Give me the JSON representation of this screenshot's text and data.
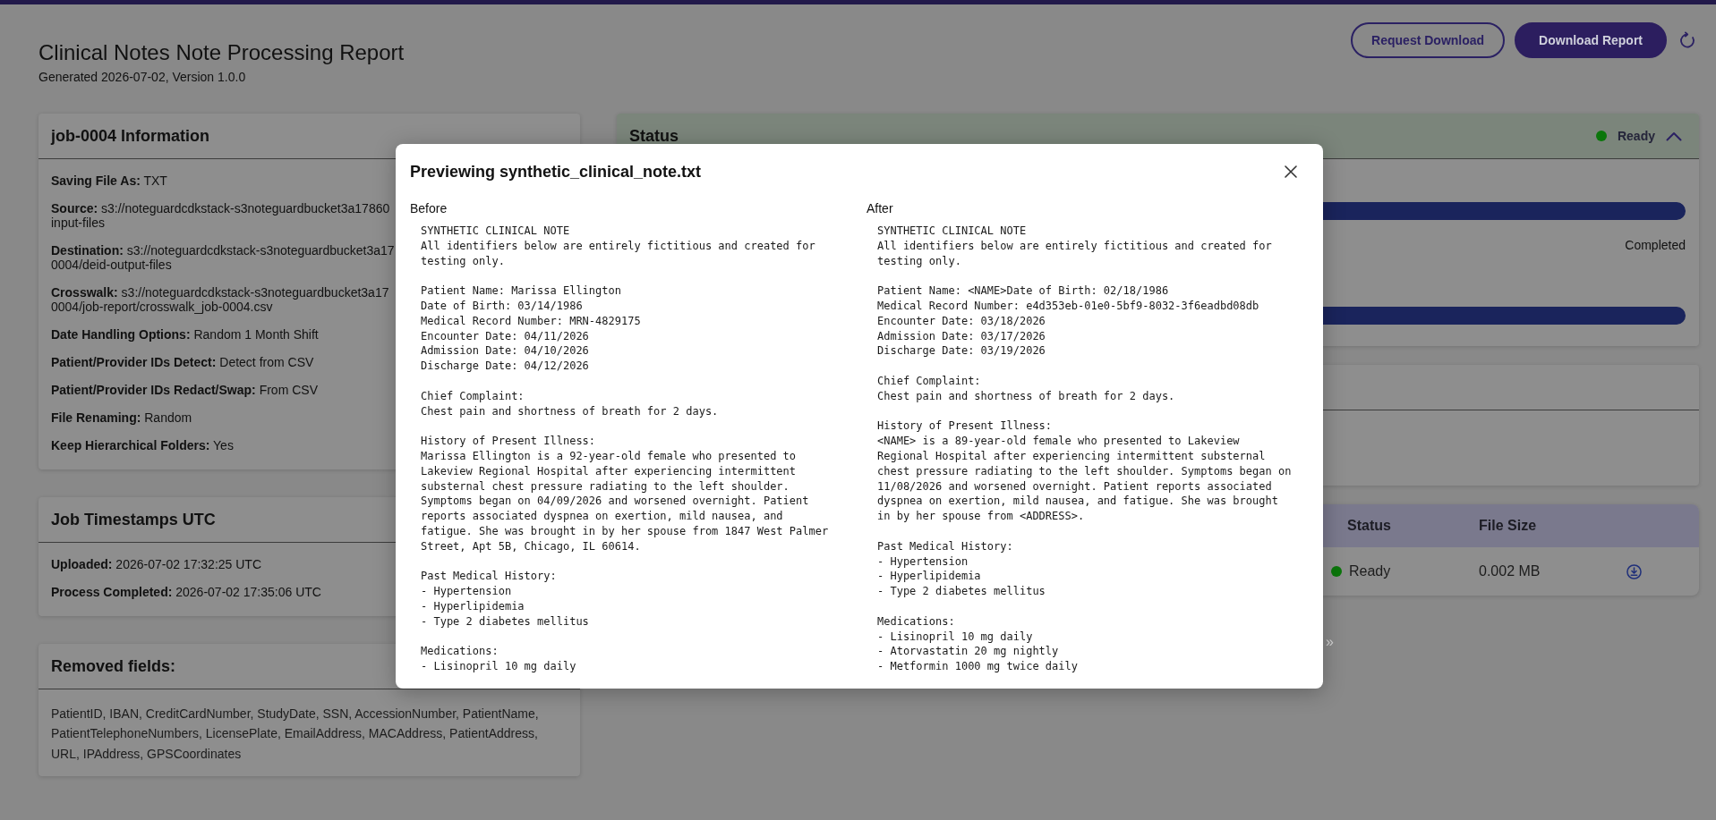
{
  "header": {
    "title": "Clinical Notes Note Processing Report",
    "subtitle": "Generated 2026-07-02, Version 1.0.0",
    "buttons": [
      {
        "label": "Request Download",
        "kind": "outline"
      },
      {
        "label": "Download Report",
        "kind": "filled"
      }
    ]
  },
  "info_card": {
    "title": "job-0004 Information",
    "rows": [
      {
        "label": "Saving File As:",
        "lines": [
          "TXT"
        ]
      },
      {
        "label": "Source:",
        "lines": [
          "s3://noteguardcdkstack-s3noteguardbucket3a17860",
          "input-files"
        ]
      },
      {
        "label": "Destination:",
        "lines": [
          "s3://noteguardcdkstack-s3noteguardbucket3a17",
          "0004/deid-output-files"
        ]
      },
      {
        "label": "Crosswalk:",
        "lines": [
          "s3://noteguardcdkstack-s3noteguardbucket3a17",
          "0004/job-report/crosswalk_job-0004.csv"
        ]
      },
      {
        "label": "Date Handling Options:",
        "lines": [
          "Random 1 Month Shift"
        ]
      },
      {
        "label": "Patient/Provider IDs Detect:",
        "lines": [
          "Detect from CSV"
        ]
      },
      {
        "label": "Patient/Provider IDs Redact/Swap:",
        "lines": [
          "From CSV"
        ]
      },
      {
        "label": "File Renaming:",
        "lines": [
          "Random"
        ]
      },
      {
        "label": "Keep Hierarchical Folders:",
        "lines": [
          "Yes"
        ]
      }
    ]
  },
  "timestamps_card": {
    "title": "Job Timestamps UTC",
    "rows": [
      {
        "label": "Uploaded:",
        "lines": [
          "2026-07-02 17:32:25 UTC"
        ]
      },
      {
        "label": "Process Completed:",
        "lines": [
          "2026-07-02 17:35:06 UTC"
        ]
      }
    ]
  },
  "removed_fields_card": {
    "title": "Removed fields:",
    "text": "PatientID, IBAN, CreditCardNumber, StudyDate, SSN, AccessionNumber, PatientName, PatientTelephoneNumbers, LicensePlate, EmailAddress, MACAddress, PatientAddress, URL, IPAddress, GPSCoordinates"
  },
  "status_card": {
    "title": "Status",
    "status": {
      "label": "Ready",
      "color": "#0b760b"
    },
    "expanded": true,
    "progress": [
      {
        "level": 1,
        "state": "Completed"
      },
      {
        "level": 1
      }
    ]
  },
  "files_table": {
    "columns": [
      "Status",
      "File Size"
    ],
    "rows": [
      {
        "status": "Ready",
        "color": "#0b760b",
        "file_size": "0.002 MB"
      }
    ],
    "pagination": {
      "next": "»"
    }
  },
  "preview_modal": {
    "title": "Previewing synthetic_clinical_note.txt",
    "panes": [
      {
        "label": "Before",
        "blocks": [
          [
            "SYNTHETIC CLINICAL NOTE",
            "All identifiers below are entirely fictitious and created for",
            "testing only."
          ],
          [
            "Patient Name: Marissa Ellington",
            "Date of Birth: 03/14/1986",
            "Medical Record Number: MRN-4829175",
            "Encounter Date: 04/11/2026",
            "Admission Date: 04/10/2026",
            "Discharge Date: 04/12/2026"
          ],
          [
            "Chief Complaint:",
            "Chest pain and shortness of breath for 2 days."
          ],
          [
            "History of Present Illness:",
            "Marissa Ellington is a 92-year-old female who presented to",
            "Lakeview Regional Hospital after experiencing intermittent",
            "substernal chest pressure radiating to the left shoulder.",
            "Symptoms began on 04/09/2026 and worsened overnight. Patient",
            "reports associated dyspnea on exertion, mild nausea, and",
            "fatigue. She was brought in by her spouse from 1847 West Palmer",
            "Street, Apt 5B, Chicago, IL 60614."
          ],
          [
            "Past Medical History:",
            "- Hypertension",
            "- Hyperlipidemia",
            "- Type 2 diabetes mellitus"
          ],
          [
            "Medications:",
            "- Lisinopril 10 mg daily"
          ]
        ]
      },
      {
        "label": "After",
        "blocks": [
          [
            "SYNTHETIC CLINICAL NOTE",
            "All identifiers below are entirely fictitious and created for",
            "testing only."
          ],
          [
            "Patient Name: <NAME>Date of Birth: 02/18/1986",
            "Medical Record Number: e4d353eb-01e0-5bf9-8032-3f6eadbd08db",
            "Encounter Date: 03/18/2026",
            "Admission Date: 03/17/2026",
            "Discharge Date: 03/19/2026"
          ],
          [
            "Chief Complaint:",
            "Chest pain and shortness of breath for 2 days."
          ],
          [
            "History of Present Illness:",
            "<NAME> is a 89-year-old female who presented to Lakeview",
            "Regional Hospital after experiencing intermittent substernal",
            "chest pressure radiating to the left shoulder. Symptoms began on",
            "11/08/2026 and worsened overnight. Patient reports associated",
            "dyspnea on exertion, mild nausea, and fatigue. She was brought",
            "in by her spouse from <ADDRESS>."
          ],
          [
            "Past Medical History:",
            "- Hypertension",
            "- Hyperlipidemia",
            "- Type 2 diabetes mellitus"
          ],
          [
            "Medications:",
            "- Lisinopril 10 mg daily",
            "- Atorvastatin 20 mg nightly",
            "- Metformin 1000 mg twice daily"
          ]
        ]
      }
    ]
  }
}
